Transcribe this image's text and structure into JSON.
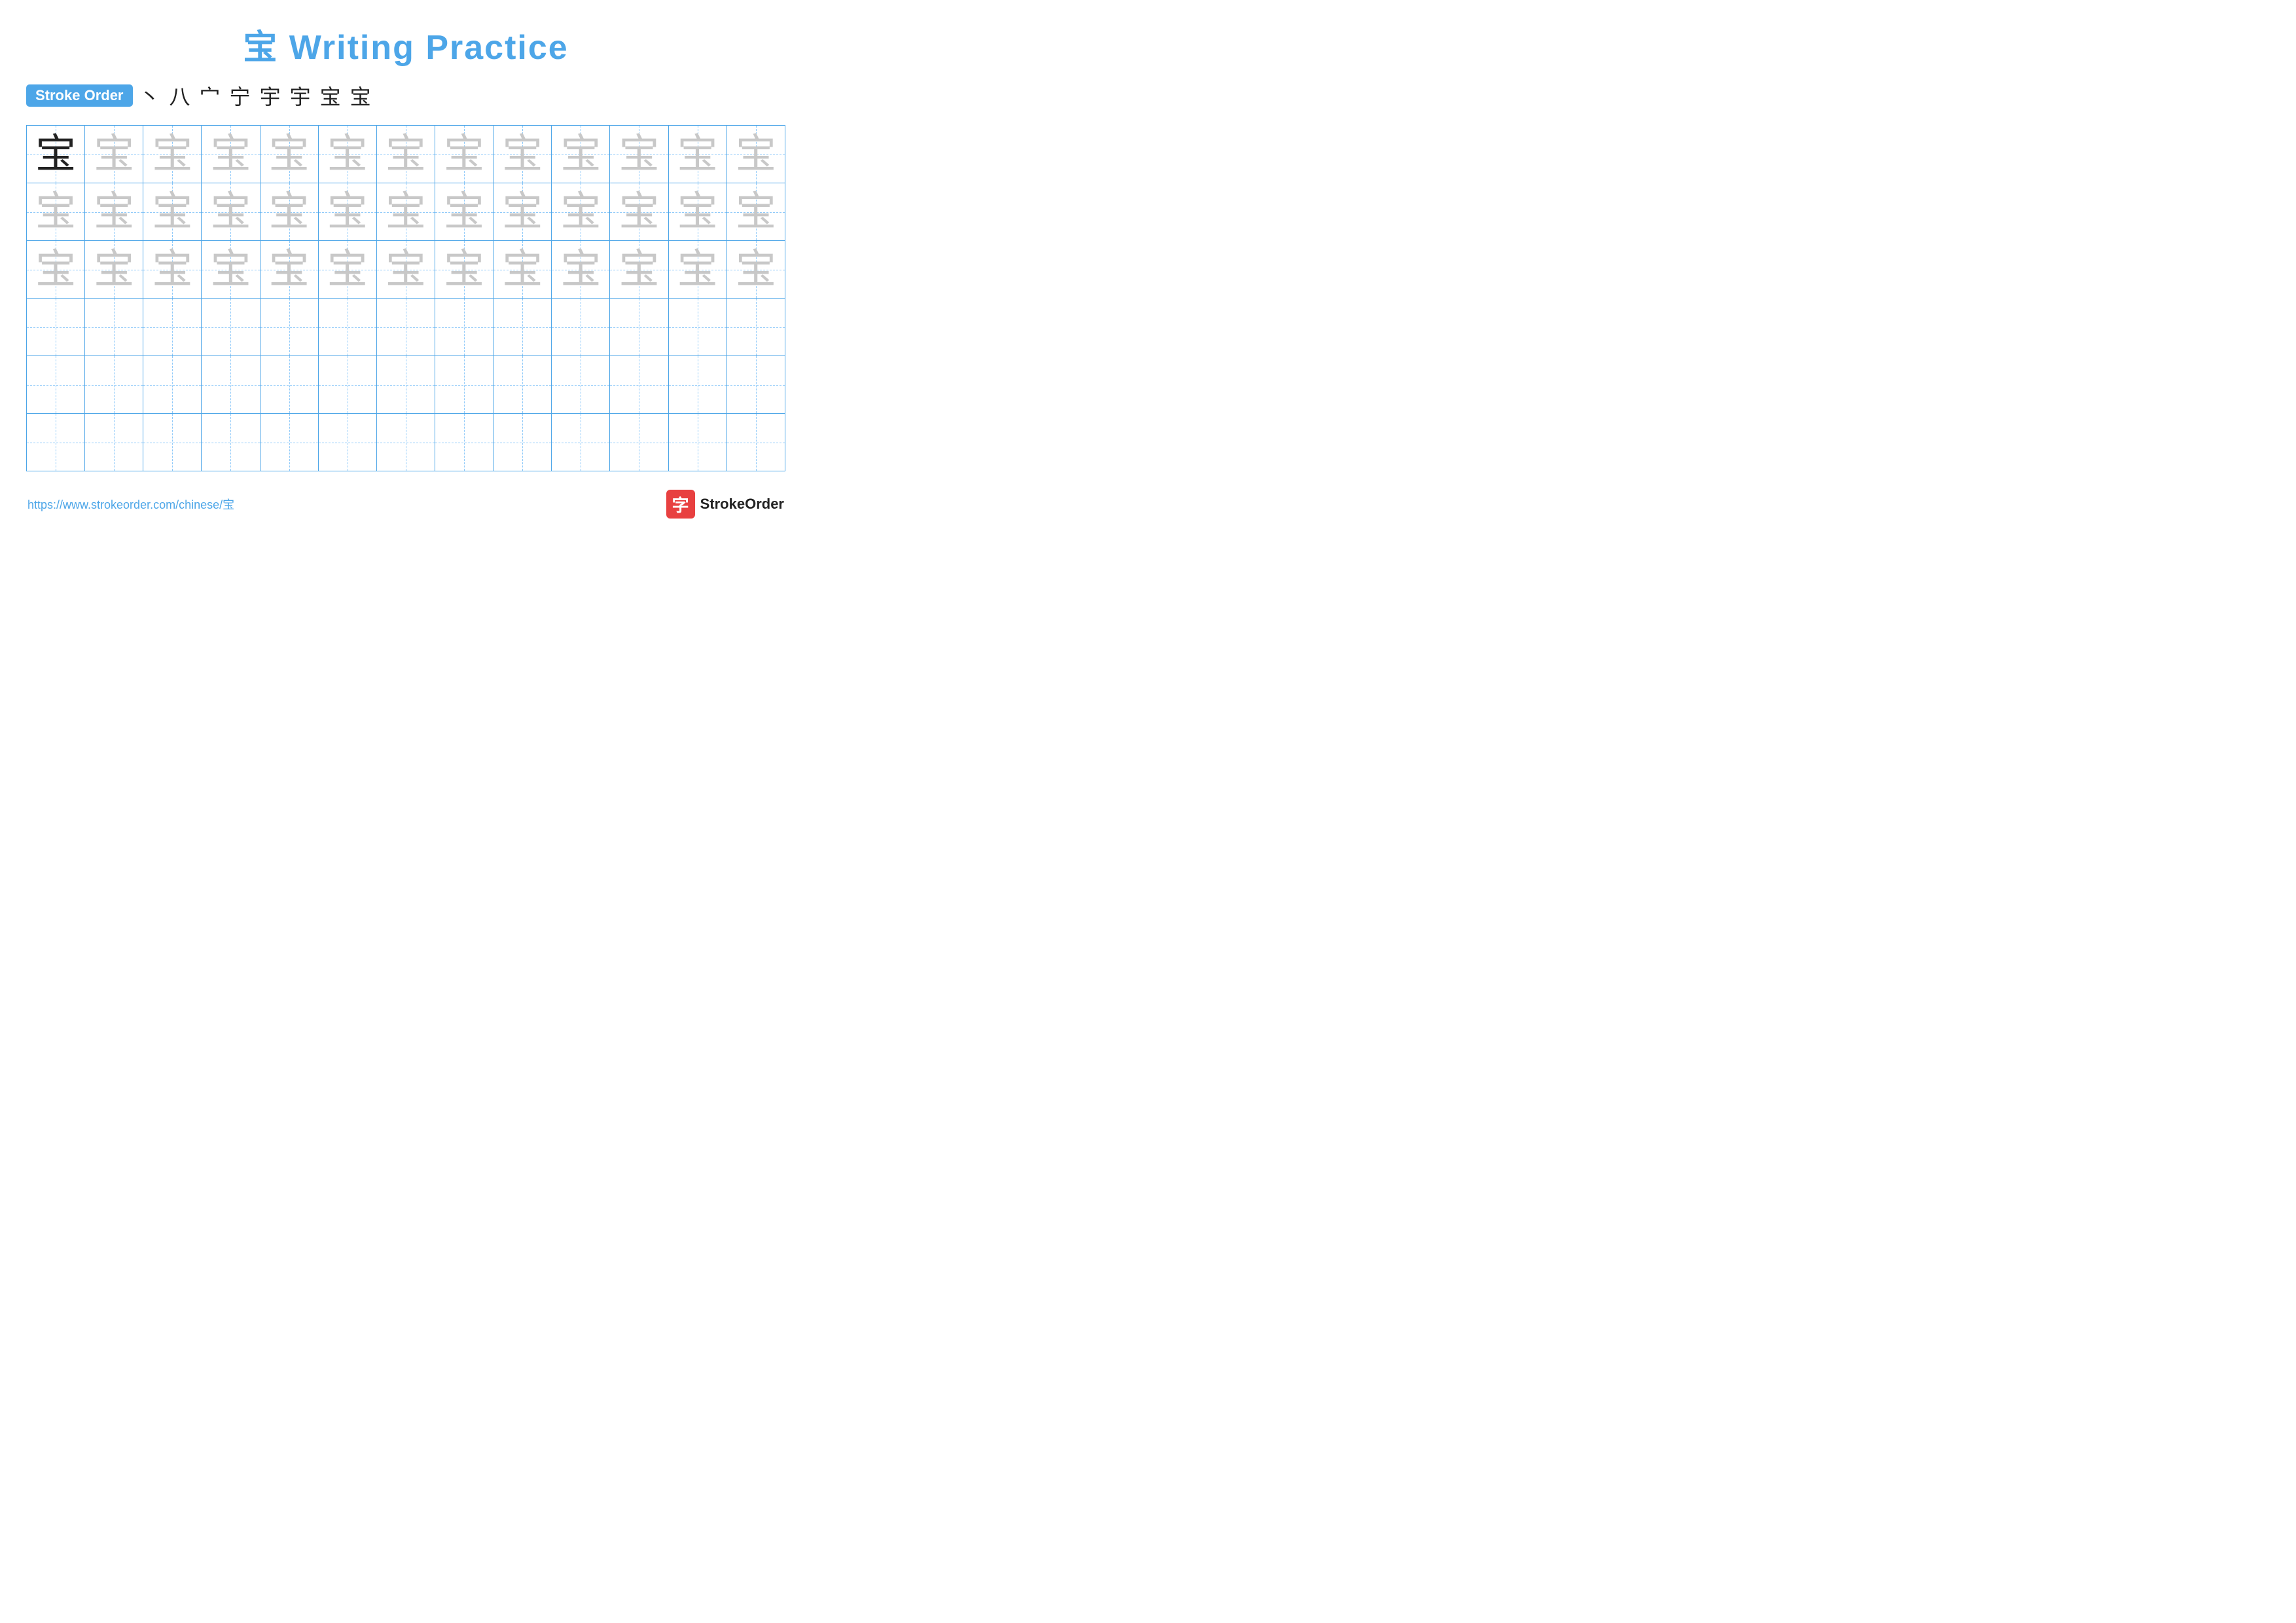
{
  "title": {
    "text": "宝 Writing Practice",
    "character": "宝"
  },
  "stroke_order": {
    "badge_label": "Stroke Order",
    "strokes": [
      "丶",
      "八",
      "宀",
      "宁",
      "宇",
      "宇",
      "宝",
      "宝"
    ]
  },
  "grid": {
    "rows": 6,
    "cols": 13,
    "character": "宝"
  },
  "footer": {
    "url": "https://www.strokeorder.com/chinese/宝",
    "logo_char": "字",
    "logo_text": "StrokeOrder"
  }
}
